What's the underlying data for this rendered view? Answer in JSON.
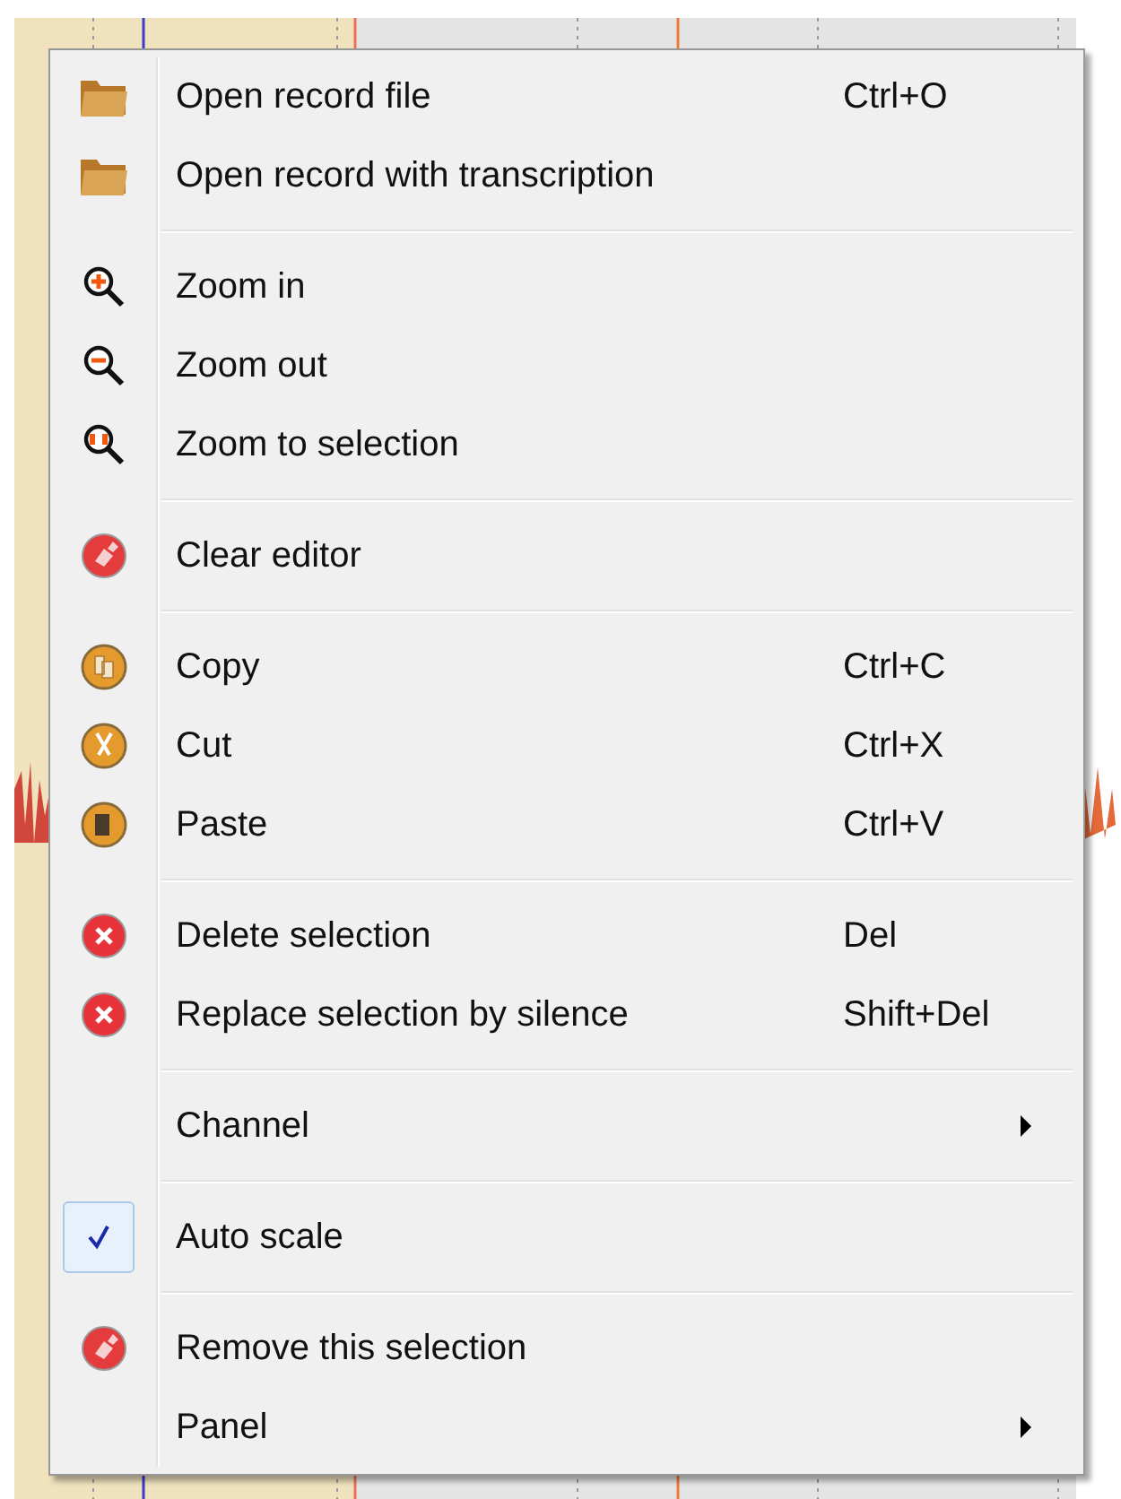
{
  "menu": {
    "sections": [
      {
        "items": [
          {
            "kind": "open",
            "label": "Open record file",
            "shortcut": "Ctrl+O",
            "checked": false
          },
          {
            "kind": "open",
            "label": "Open record with transcription",
            "checked": false
          }
        ]
      },
      {
        "items": [
          {
            "kind": "zoom-in",
            "label": "Zoom in",
            "checked": false
          },
          {
            "kind": "zoom-out",
            "label": "Zoom out",
            "checked": false
          },
          {
            "kind": "zoom-selection",
            "label": "Zoom to selection",
            "checked": false
          }
        ]
      },
      {
        "items": [
          {
            "kind": "clear",
            "label": "Clear editor",
            "checked": false
          }
        ]
      },
      {
        "items": [
          {
            "kind": "copy",
            "label": "Copy",
            "shortcut": "Ctrl+C",
            "checked": false
          },
          {
            "kind": "cut",
            "label": "Cut",
            "shortcut": "Ctrl+X",
            "checked": false
          },
          {
            "kind": "paste",
            "label": "Paste",
            "shortcut": "Ctrl+V",
            "checked": false
          }
        ]
      },
      {
        "items": [
          {
            "kind": "delete",
            "label": "Delete selection",
            "shortcut": "Del",
            "checked": false
          },
          {
            "kind": "delete",
            "label": "Replace selection by silence",
            "shortcut": "Shift+Del",
            "checked": false
          }
        ]
      },
      {
        "items": [
          {
            "kind": "submenu",
            "label": "Channel",
            "checked": false
          }
        ]
      },
      {
        "items": [
          {
            "kind": "plain",
            "label": "Auto scale",
            "checked": true
          }
        ]
      },
      {
        "items": [
          {
            "kind": "clear",
            "label": "Remove this selection",
            "checked": false
          },
          {
            "kind": "submenu",
            "label": "Panel",
            "checked": false
          }
        ]
      }
    ]
  }
}
